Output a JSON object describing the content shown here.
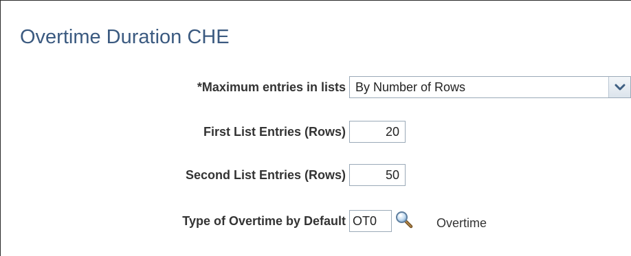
{
  "page": {
    "title": "Overtime Duration CHE"
  },
  "form": {
    "max_entries": {
      "label": "*Maximum entries in lists",
      "value": "By Number of Rows"
    },
    "first_list": {
      "label": "First List Entries (Rows)",
      "value": "20"
    },
    "second_list": {
      "label": "Second List Entries (Rows)",
      "value": "50"
    },
    "overtime_type": {
      "label": "Type of Overtime by Default",
      "value": "OT0",
      "description": "Overtime"
    }
  },
  "icons": {
    "dropdown": "chevron-down-icon",
    "lookup": "magnifier-icon"
  },
  "colors": {
    "title": "#3b5a80",
    "label": "#333333",
    "border": "#9aa9b7"
  }
}
